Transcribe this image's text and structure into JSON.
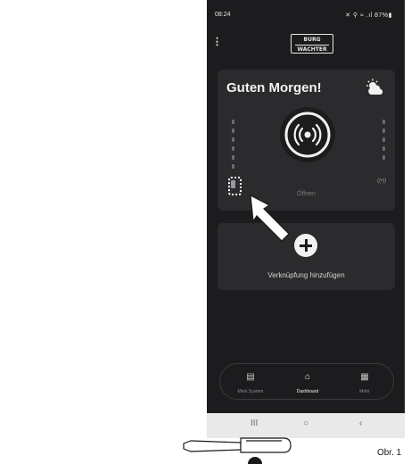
{
  "status_bar": {
    "time": "08:24",
    "icons": "✕ ⚲ ≈ .ıl 87%▮"
  },
  "app_bar": {
    "menu_icon": "more-vertical-icon",
    "logo_line1": "BURG",
    "logo_line2": "WACHTER"
  },
  "lock_card": {
    "greeting": "Guten Morgen!",
    "weather_icon": "partly-cloudy-icon",
    "action_icon": "signal-broadcast-icon",
    "action_label": "Öffnen",
    "right_signal_label": "((•))"
  },
  "shortcut_card": {
    "add_icon": "plus-icon",
    "label": "Verknüpfung hinzufügen"
  },
  "bottom_nav": {
    "items": [
      {
        "label": "Mein System",
        "icon": "list-icon",
        "glyph": "▤"
      },
      {
        "label": "Dashboard",
        "icon": "home-icon",
        "glyph": "⌂"
      },
      {
        "label": "Mehr",
        "icon": "grid-plus-icon",
        "glyph": "▦"
      }
    ],
    "active_index": 1
  },
  "system_nav": {
    "recents": "III",
    "home": "○",
    "back": "‹"
  },
  "caption": "Obr. 1"
}
